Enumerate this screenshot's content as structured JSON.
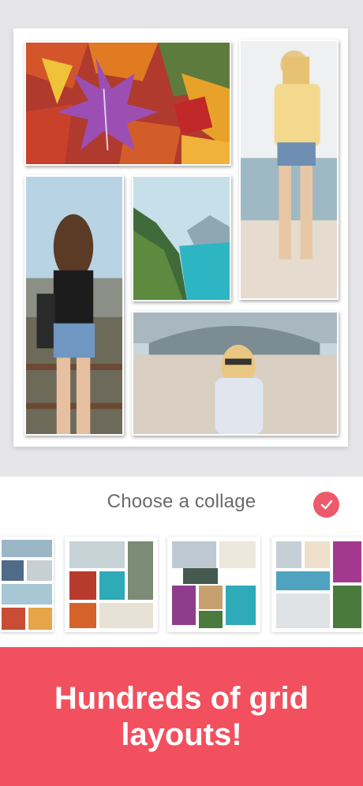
{
  "collage": {
    "photos": [
      {
        "id": "autumn-leaves-photo"
      },
      {
        "id": "beach-woman-photo"
      },
      {
        "id": "woman-back-view-photo"
      },
      {
        "id": "lake-mountain-photo"
      },
      {
        "id": "woman-sunglasses-photo"
      }
    ]
  },
  "picker": {
    "title": "Choose a collage",
    "confirm_icon": "checkmark-icon"
  },
  "layouts": [
    {
      "name": "layout-option-1"
    },
    {
      "name": "layout-option-2"
    },
    {
      "name": "layout-option-3"
    },
    {
      "name": "layout-option-4"
    }
  ],
  "promo": {
    "text": "Hundreds of grid\nlayouts!"
  },
  "colors": {
    "accent": "#f2505f",
    "check": "#ec5a6b",
    "title_text": "#6a6a6a"
  }
}
